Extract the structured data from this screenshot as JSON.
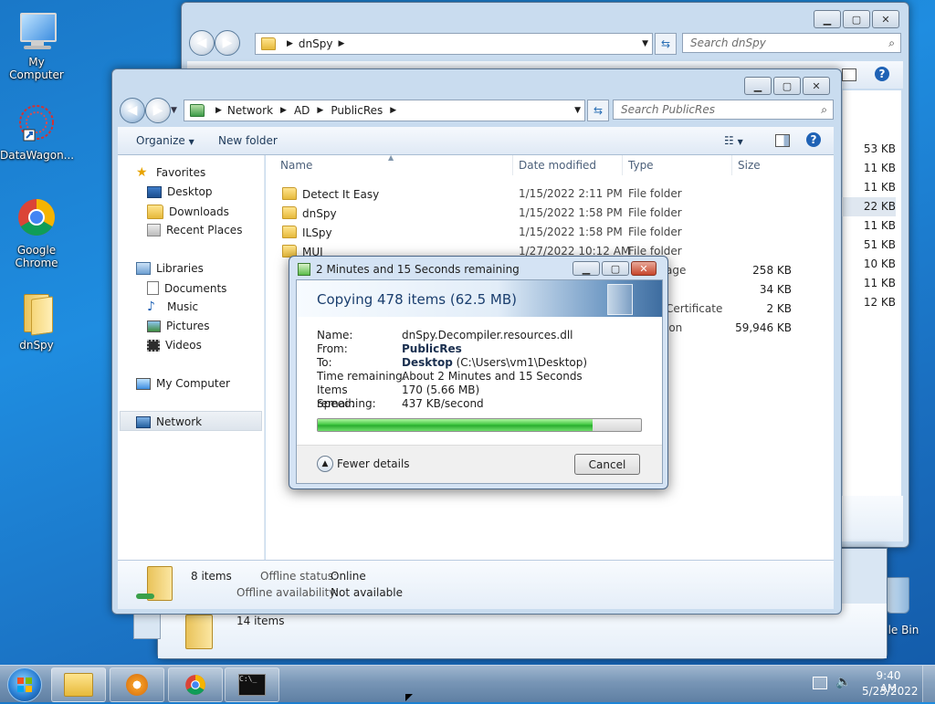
{
  "desktop": {
    "icons": [
      {
        "label": "My Computer"
      },
      {
        "label": "DataWagon..."
      },
      {
        "label": "Google Chrome"
      },
      {
        "label": "dnSpy"
      }
    ],
    "recycle_label": "cle Bin"
  },
  "back_window": {
    "address": [
      "dnSpy"
    ],
    "search_placeholder": "Search dnSpy",
    "sizes": [
      "53 KB",
      "11 KB",
      "11 KB",
      "22 KB",
      "11 KB",
      "51 KB",
      "10 KB",
      "11 KB",
      "12 KB"
    ],
    "status": "14 items"
  },
  "explorer": {
    "address": [
      "Network",
      "AD",
      "PublicRes"
    ],
    "search_placeholder": "Search PublicRes",
    "toolbar": {
      "organize": "Organize",
      "new_folder": "New folder"
    },
    "nav": {
      "favorites": "Favorites",
      "desktop": "Desktop",
      "downloads": "Downloads",
      "recent": "Recent Places",
      "libraries": "Libraries",
      "documents": "Documents",
      "music": "Music",
      "pictures": "Pictures",
      "videos": "Videos",
      "computer": "My Computer",
      "network": "Network"
    },
    "columns": {
      "name": "Name",
      "date": "Date modified",
      "type": "Type",
      "size": "Size"
    },
    "files": [
      {
        "name": "Detect It Easy",
        "date": "1/15/2022 2:11 PM",
        "type": "File folder",
        "size": ""
      },
      {
        "name": "dnSpy",
        "date": "1/15/2022 1:58 PM",
        "type": "File folder",
        "size": ""
      },
      {
        "name": "ILSpy",
        "date": "1/15/2022 1:58 PM",
        "type": "File folder",
        "size": ""
      },
      {
        "name": "MUI",
        "date": "1/27/2022 10:12 AM",
        "type": "File folder",
        "size": ""
      },
      {
        "name": "",
        "date": "",
        "type": "age",
        "size": "258 KB"
      },
      {
        "name": "",
        "date": "",
        "type": "",
        "size": "34 KB"
      },
      {
        "name": "",
        "date": "",
        "type": "Certificate",
        "size": "2 KB"
      },
      {
        "name": "",
        "date": "",
        "type": "ion",
        "size": "59,946 KB"
      }
    ],
    "details": {
      "count": "8 items",
      "offline_status_label": "Offline status:",
      "offline_status_value": "Online",
      "offline_avail_label": "Offline availability:",
      "offline_avail_value": "Not available"
    }
  },
  "copy_dialog": {
    "title": "2 Minutes and 15 Seconds remaining",
    "heading": "Copying 478 items (62.5 MB)",
    "rows": [
      {
        "label": "Name:",
        "value": "dnSpy.Decompiler.resources.dll",
        "bold": ""
      },
      {
        "label": "From:",
        "value": "",
        "bold": "PublicRes"
      },
      {
        "label": "To:",
        "value": " (C:\\Users\\vm1\\Desktop)",
        "bold": "Desktop"
      },
      {
        "label": "Time remaining:",
        "value": "About 2 Minutes and 15 Seconds",
        "bold": ""
      },
      {
        "label": "Items remaining:",
        "value": "170 (5.66 MB)",
        "bold": ""
      },
      {
        "label": "Speed:",
        "value": "437 KB/second",
        "bold": ""
      }
    ],
    "progress": 0.85,
    "fewer_details": "Fewer details",
    "cancel": "Cancel"
  },
  "taskbar": {
    "time": "9:40 AM",
    "date": "5/23/2022"
  }
}
